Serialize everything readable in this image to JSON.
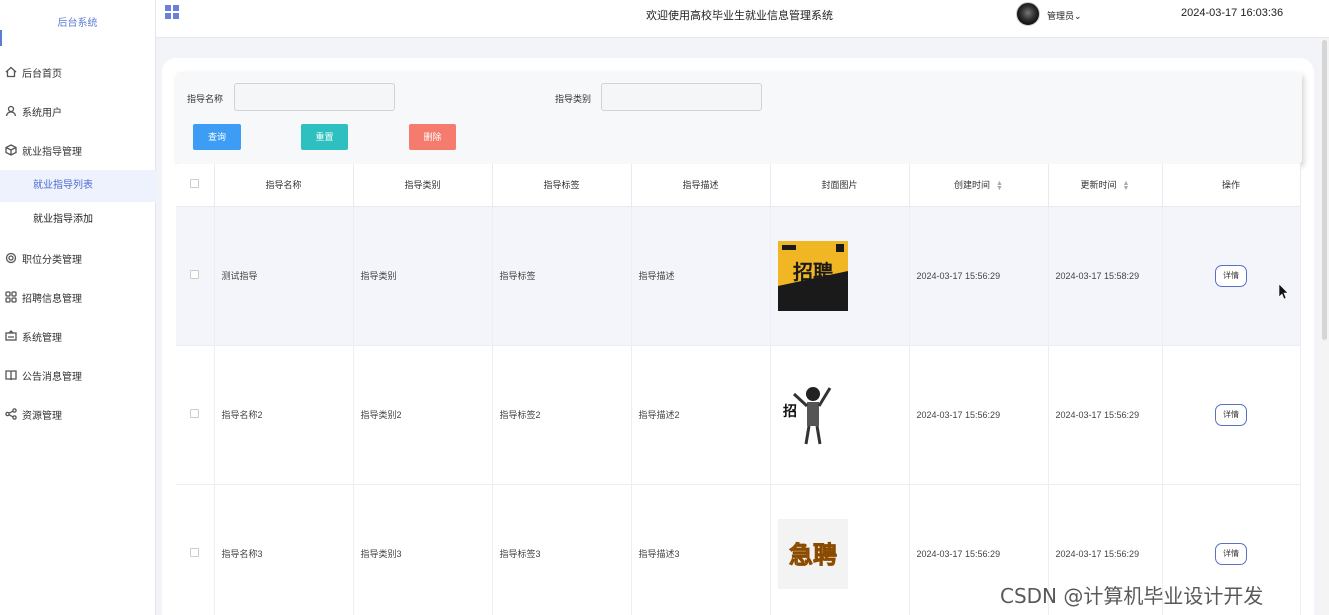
{
  "sidebar": {
    "brand": "后台系统",
    "items": [
      {
        "label": "后台首页",
        "icon": "home-icon"
      },
      {
        "label": "系统用户",
        "icon": "user-icon"
      },
      {
        "label": "就业指导管理",
        "icon": "cube-icon"
      },
      {
        "label": "职位分类管理",
        "icon": "settings-icon"
      },
      {
        "label": "招聘信息管理",
        "icon": "grid-icon"
      },
      {
        "label": "系统管理",
        "icon": "monitor-icon"
      },
      {
        "label": "公告消息管理",
        "icon": "book-icon"
      },
      {
        "label": "资源管理",
        "icon": "share-icon"
      }
    ],
    "sub_items": [
      {
        "label": "就业指导列表",
        "active": true
      },
      {
        "label": "就业指导添加",
        "active": false
      }
    ]
  },
  "header": {
    "welcome": "欢迎使用高校毕业生就业信息管理系统",
    "user": "管理员",
    "datetime": "2024-03-17 16:03:36"
  },
  "search": {
    "name_label": "指导名称",
    "name_value": "",
    "category_label": "指导类别",
    "category_value": "",
    "query_button": "查询",
    "reset_button": "重置",
    "delete_button": "删除"
  },
  "table": {
    "columns": [
      "指导名称",
      "指导类别",
      "指导标签",
      "指导描述",
      "封面图片",
      "创建时间",
      "更新时间",
      "操作"
    ],
    "rows": [
      {
        "name": "测试指导",
        "category": "指导类别",
        "tag": "指导标签",
        "desc": "指导描述",
        "created": "2024-03-17 15:56:29",
        "updated": "2024-03-17 15:58:29",
        "action": "详情",
        "cover_text": "招聘"
      },
      {
        "name": "指导名称2",
        "category": "指导类别2",
        "tag": "指导标签2",
        "desc": "指导描述2",
        "created": "2024-03-17 15:56:29",
        "updated": "2024-03-17 15:56:29",
        "action": "详情",
        "cover_text": "招"
      },
      {
        "name": "指导名称3",
        "category": "指导类别3",
        "tag": "指导标签3",
        "desc": "指导描述3",
        "created": "2024-03-17 15:56:29",
        "updated": "2024-03-17 15:56:29",
        "action": "详情",
        "cover_text": "急聘"
      }
    ]
  },
  "watermark": "CSDN @计算机毕业设计开发",
  "colors": {
    "accent": "#4b6cd2",
    "query": "#3d9cf3",
    "reset": "#2ec0c0",
    "delete": "#f47b6e"
  }
}
